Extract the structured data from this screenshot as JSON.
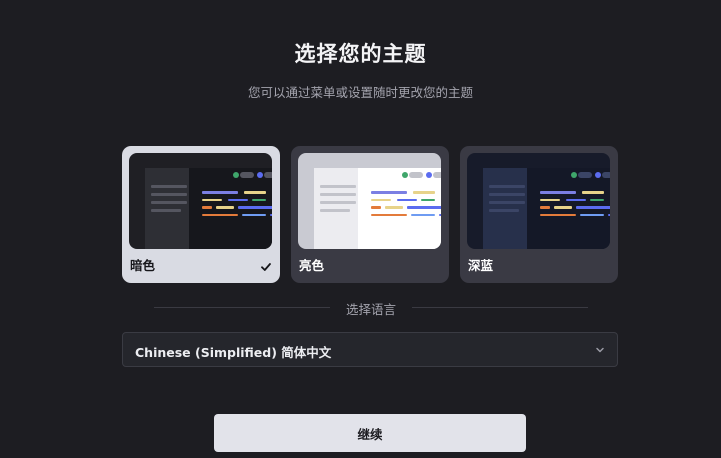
{
  "header": {
    "title": "选择您的主题",
    "subtitle": "您可以通过菜单或设置随时更改您的主题"
  },
  "themes": [
    {
      "label": "暗色",
      "selected": true,
      "colors": {
        "bg": "#1f1f24",
        "sidebar": "#2e2f35",
        "main": "#16171c",
        "bar": "#555660"
      }
    },
    {
      "label": "亮色",
      "selected": false,
      "colors": {
        "bg": "#c9cad2",
        "sidebar": "#ececf0",
        "main": "#ffffff",
        "bar": "#c2c3ca"
      }
    },
    {
      "label": "深蓝",
      "selected": false,
      "colors": {
        "bg": "#171b2a",
        "sidebar": "#27304b",
        "main": "#141827",
        "bar": "#3b4566"
      }
    }
  ],
  "language_section": {
    "label": "选择语言",
    "selected": "Chinese (Simplified) 简体中文"
  },
  "continue_button": {
    "label": "继续"
  },
  "accent_colors": {
    "green": "#3fa66b",
    "blue": "#5b6cf0",
    "purple": "#7b7fe3",
    "yellow": "#e7d38a",
    "orange": "#e37b3b",
    "light_blue": "#6f9cf2"
  }
}
